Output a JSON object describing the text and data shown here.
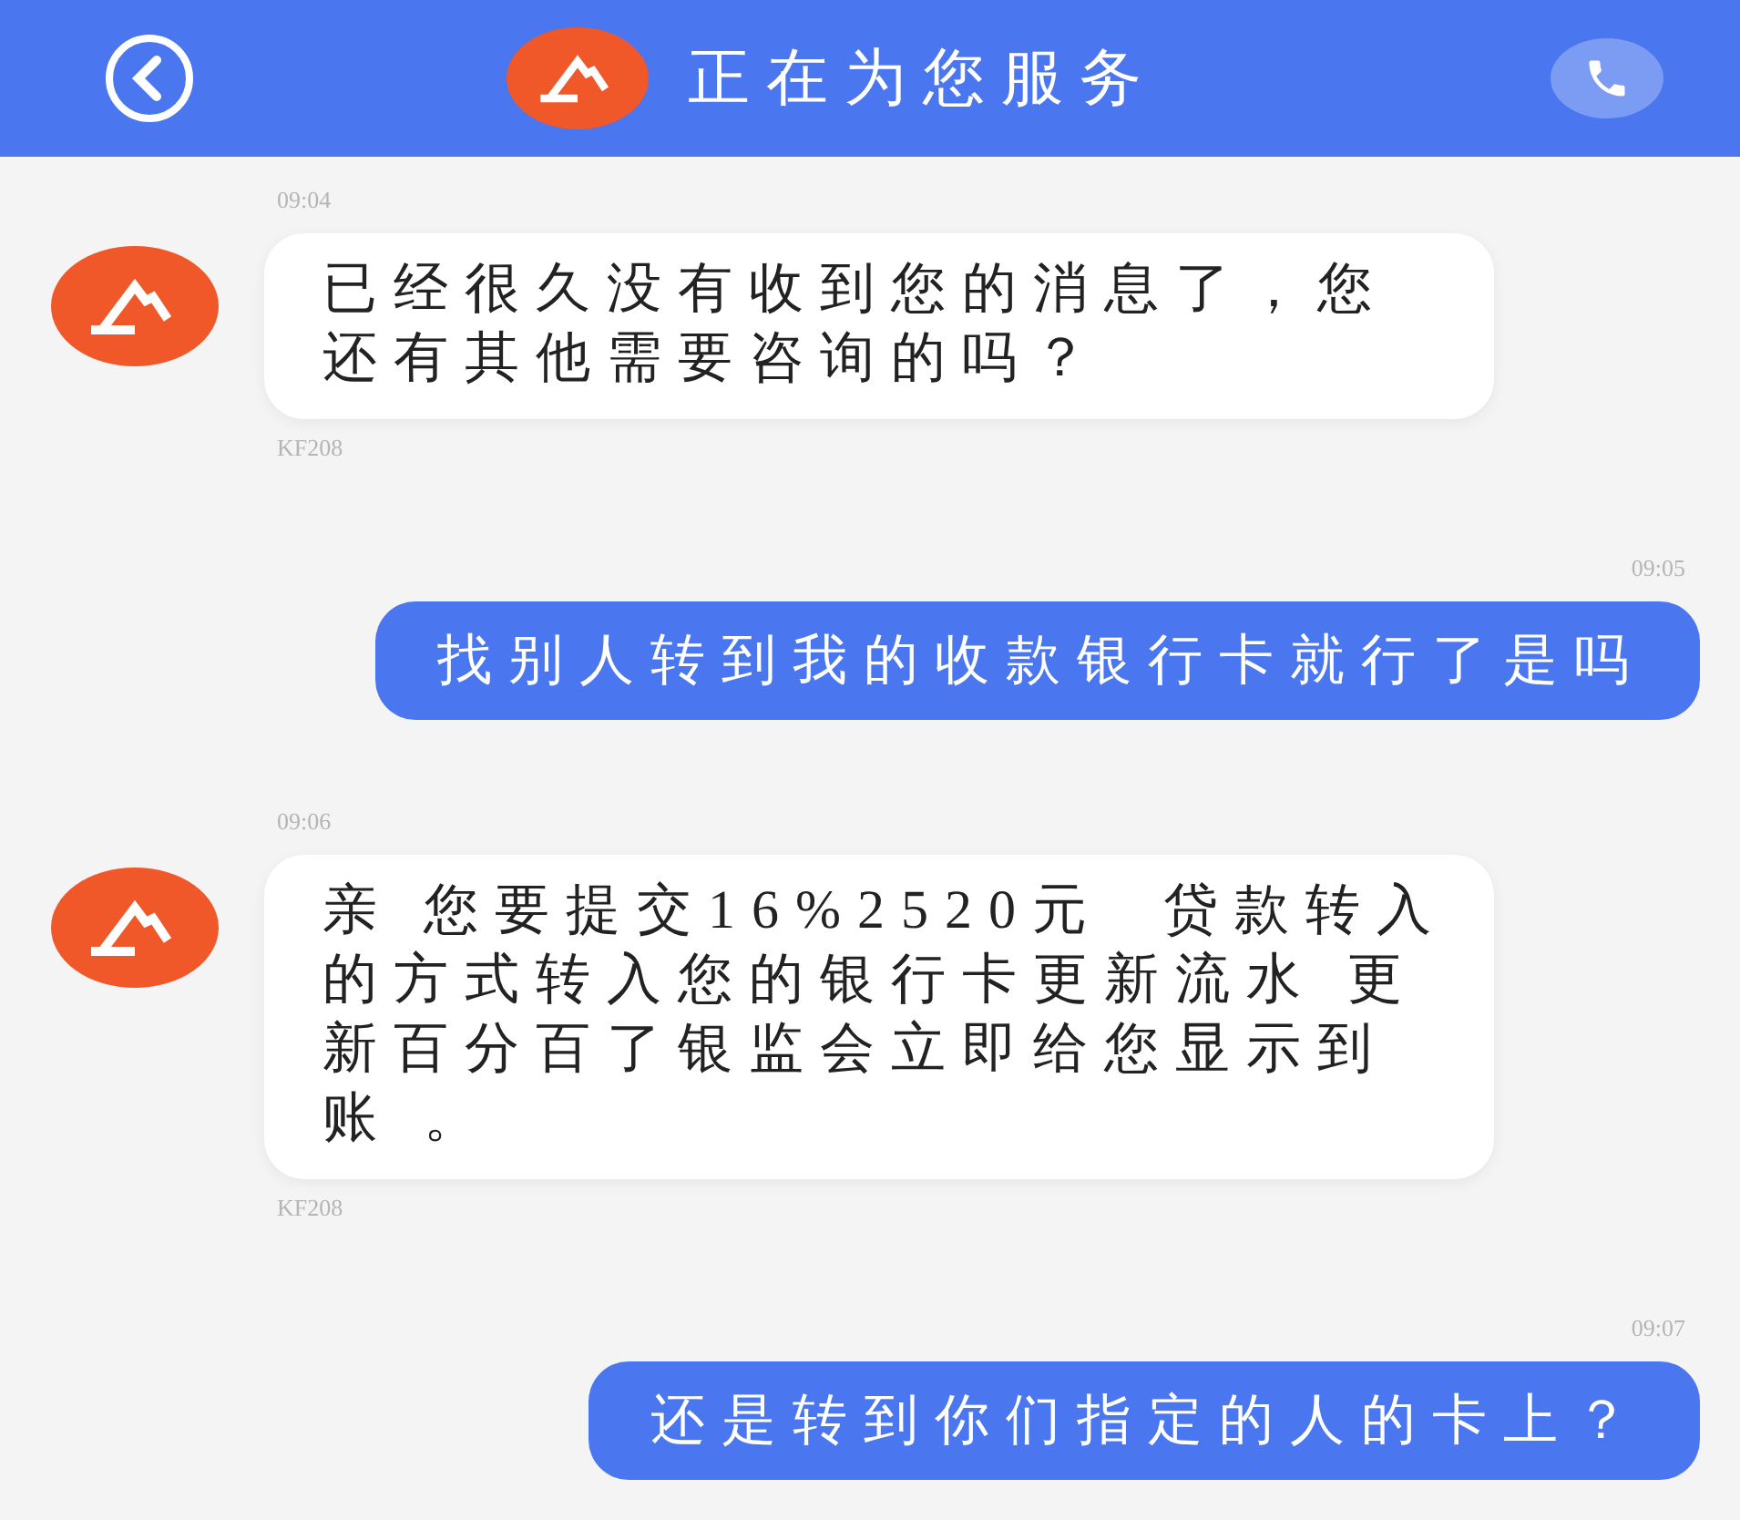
{
  "header": {
    "title": "正在为您服务"
  },
  "messages": [
    {
      "kind": "agent",
      "time": "09:04",
      "text": "已经很久没有收到您的消息了，您还有其他需要咨询的吗？",
      "sender": "KF208"
    },
    {
      "kind": "user",
      "time": "09:05",
      "text": "找别人转到我的收款银行卡就行了是吗"
    },
    {
      "kind": "agent",
      "time": "09:06",
      "text": "亲 您要提交16%2520元  贷款转入的方式转入您的银行卡更新流水 更新百分百了银监会立即给您显示到账 。",
      "sender": "KF208"
    },
    {
      "kind": "user",
      "time": "09:07",
      "text": "还是转到你们指定的人的卡上？"
    }
  ]
}
